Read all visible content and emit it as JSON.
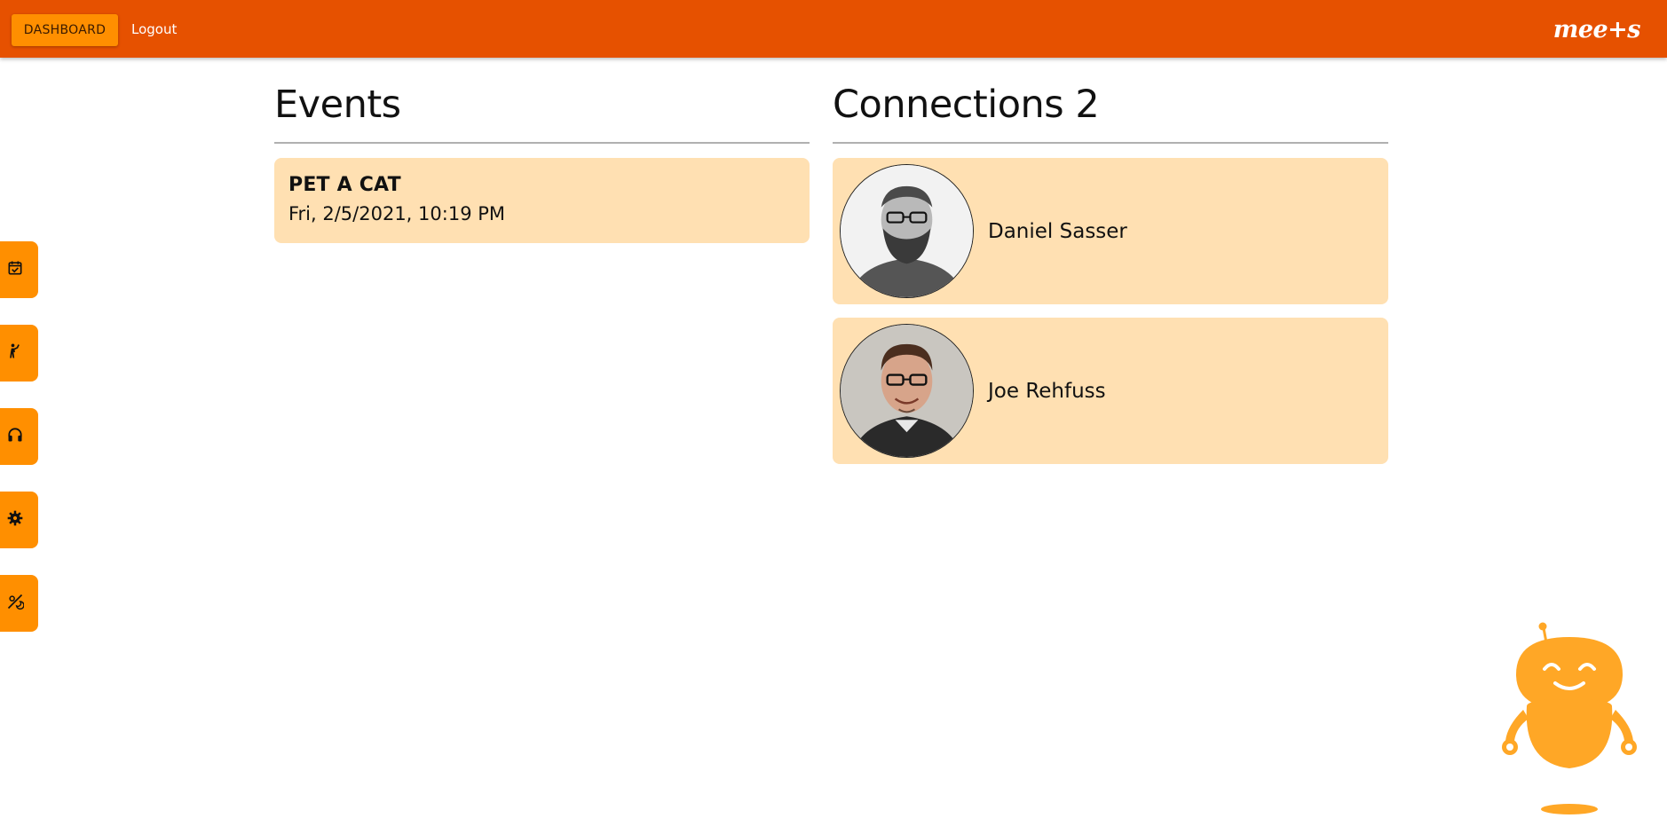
{
  "topbar": {
    "dashboard_label": "DASHBOARD",
    "logout_label": "Logout",
    "brand": "mee+s"
  },
  "sidebar": {
    "items": [
      {
        "icon": "calendar-check-icon"
      },
      {
        "icon": "person-waving-icon"
      },
      {
        "icon": "headphones-icon"
      },
      {
        "icon": "gear-icon"
      },
      {
        "icon": "theme-toggle-icon"
      }
    ]
  },
  "events": {
    "title": "Events",
    "items": [
      {
        "name": "PET A CAT",
        "date": "Fri, 2/5/2021, 10:19 PM"
      }
    ]
  },
  "connections": {
    "title": "Connections 2",
    "items": [
      {
        "name": "Daniel Sasser"
      },
      {
        "name": "Joe Rehfuss"
      }
    ]
  },
  "colors": {
    "topbar": "#e65100",
    "accent": "#ff8f00",
    "card": "#ffe0b2",
    "mascot": "#ffa726"
  }
}
